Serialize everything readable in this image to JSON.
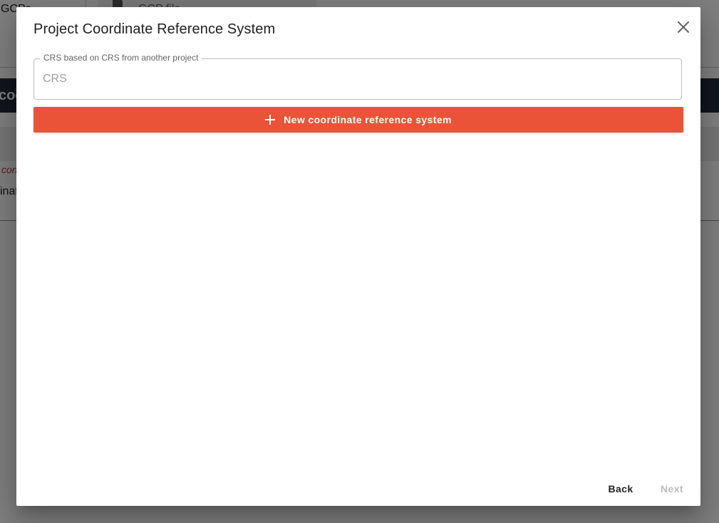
{
  "background": {
    "tab_left_label": "GCPs",
    "tab_file_label": "GCP file",
    "dark_bar_label": "coo",
    "alert_text": "con",
    "row_text": "inat"
  },
  "dialog": {
    "title": "Project Coordinate Reference System",
    "close_icon": "close-icon",
    "crs_field": {
      "legend": "CRS based on CRS from another project",
      "placeholder": "CRS",
      "value": ""
    },
    "new_crs_button": {
      "icon": "plus-icon",
      "label": "New coordinate reference system",
      "color": "#eb5338"
    },
    "back_label": "Back",
    "next_label": "Next"
  }
}
